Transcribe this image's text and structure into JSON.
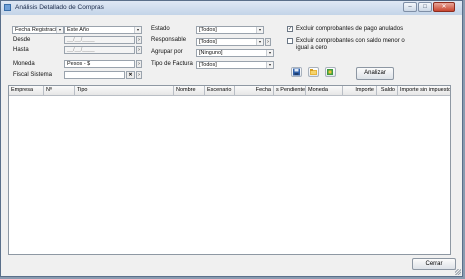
{
  "window": {
    "title": "Análisis Detallado de Compras",
    "minimize_glyph": "–",
    "maximize_glyph": "□",
    "close_glyph": "✕"
  },
  "filters": {
    "date_type": "Fecha Registraci",
    "period": "Este Año",
    "desde_label": "Desde",
    "desde_value": "__/__/____",
    "hasta_label": "Hasta",
    "hasta_value": "__/__/____",
    "moneda_label": "Moneda",
    "moneda_value": "Pesos - $",
    "fiscal_label": "Fiscal Sistema",
    "fiscal_value": "",
    "estado_label": "Estado",
    "estado_value": "[Todos]",
    "responsable_label": "Responsable",
    "responsable_value": "[Todos]",
    "agrupar_label": "Agrupar por",
    "agrupar_value": "[Ninguno]",
    "tipo_factura_label": "Tipo de Factura",
    "tipo_factura_value": "[Todos]",
    "nav_next": "›",
    "clear_glyph": "✕",
    "dropdown_glyph": "▾"
  },
  "options": {
    "excluir_anulados_label": "Excluir comprobantes de pago anulados",
    "excluir_anulados_checked": true,
    "excluir_saldo_label_line1": "Excluir comprobantes con saldo menor o",
    "excluir_saldo_label_line2": "igual a cero",
    "excluir_saldo_checked": false,
    "check_glyph": "✓"
  },
  "toolbar": {
    "save_icon": "save-icon",
    "open_icon": "folder-icon",
    "export_icon": "export-icon",
    "analizar_label": "Analizar"
  },
  "grid": {
    "columns": [
      "Empresa",
      "Nº",
      "Tipo",
      "Nombre",
      "Escenario",
      "Fecha",
      "s Pendiente",
      "Moneda",
      "Importe",
      "Saldo",
      "Importe sin impuestos"
    ]
  },
  "footer": {
    "cerrar_label": "Cerrar"
  }
}
